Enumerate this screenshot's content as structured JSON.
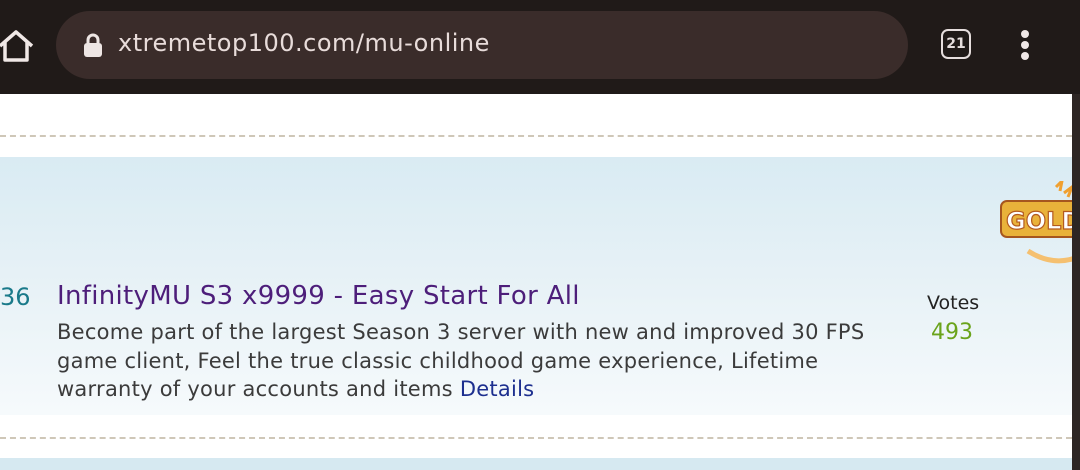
{
  "browser": {
    "url": "xtremetop100.com/mu-online",
    "tab_count": "21"
  },
  "listing": {
    "rank": "36",
    "title": "InfinityMU S3 x9999 - Easy Start For All",
    "description": "Become part of the largest Season 3 server with new and improved 30 FPS game client, Feel the true classic childhood game experience, Lifetime warranty of your accounts and items",
    "details_label": "Details",
    "votes_label": "Votes",
    "votes_count": "493",
    "badge_text": "GOLD"
  },
  "colors": {
    "title": "#4d1e7a",
    "votes": "#6aa31b",
    "details_link": "#1d2f8f"
  }
}
